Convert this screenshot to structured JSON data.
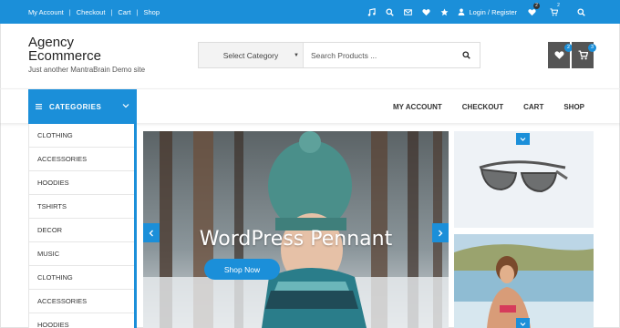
{
  "topbar": {
    "links": [
      "My Account",
      "Checkout",
      "Cart",
      "Shop"
    ],
    "separator": "|",
    "login_label": "Login / Register",
    "wishlist_count": "2",
    "cart_count": "2",
    "icons": [
      "music-icon",
      "search-icon",
      "mail-icon",
      "heart-icon",
      "star-icon",
      "user-icon",
      "heart-icon",
      "cart-icon",
      "search-icon"
    ]
  },
  "header": {
    "site_title_line1": "Agency",
    "site_title_line2": "Ecommerce",
    "tagline": "Just another MantraBrain Demo site",
    "category_select": "Select Category",
    "search_placeholder": "Search Products ...",
    "wishlist_count": "2",
    "cart_count": "3"
  },
  "nav": {
    "categories_label": "CATEGORIES",
    "menu": [
      "MY ACCOUNT",
      "CHECKOUT",
      "CART",
      "SHOP"
    ]
  },
  "sidebar": {
    "items": [
      "CLOTHING",
      "ACCESSORIES",
      "HOODIES",
      "TSHIRTS",
      "DECOR",
      "MUSIC",
      "CLOTHING",
      "ACCESSORIES",
      "HOODIES"
    ]
  },
  "slider": {
    "title": "WordPress Pennant",
    "button_label": "Shop Now"
  },
  "colors": {
    "accent": "#1b8fd9",
    "dark_button": "#555555"
  }
}
